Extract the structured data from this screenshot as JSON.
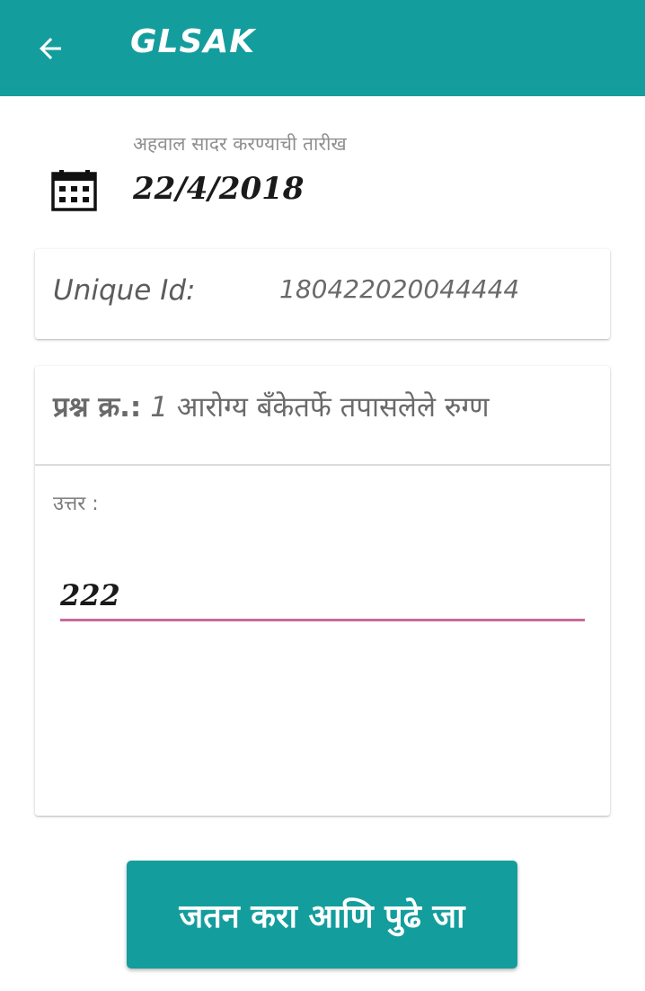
{
  "appbar": {
    "title": "GLSAK",
    "back_icon": "arrow-left-icon",
    "color": "#149d9d"
  },
  "report_date": {
    "label": "अहवाल सादर करण्याची तारीख",
    "value": "22/4/2018",
    "icon": "calendar-icon"
  },
  "unique_id": {
    "label": "Unique Id:",
    "value": "180422020044444"
  },
  "question": {
    "prefix": "प्रश्न क्र.:",
    "number": "1",
    "text": "आरोग्य बँकेतर्फे तपासलेले रुग्ण",
    "answer_label": "उत्तर :",
    "answer_value": "222",
    "underline_color": "#c66a9c"
  },
  "submit_button": {
    "label": "जतन करा आणि पुढे जा"
  }
}
